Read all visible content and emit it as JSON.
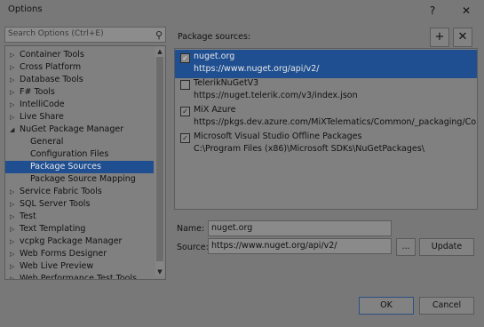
{
  "window": {
    "title": "Options",
    "help": "?",
    "close": "✕"
  },
  "search": {
    "placeholder": "Search Options (Ctrl+E)"
  },
  "tree": [
    {
      "label": "Container Tools",
      "arrow": "▷",
      "indent": 0
    },
    {
      "label": "Cross Platform",
      "arrow": "▷",
      "indent": 0
    },
    {
      "label": "Database Tools",
      "arrow": "▷",
      "indent": 0
    },
    {
      "label": "F# Tools",
      "arrow": "▷",
      "indent": 0
    },
    {
      "label": "IntelliCode",
      "arrow": "▷",
      "indent": 0
    },
    {
      "label": "Live Share",
      "arrow": "▷",
      "indent": 0
    },
    {
      "label": "NuGet Package Manager",
      "arrow": "◢",
      "indent": 0
    },
    {
      "label": "General",
      "arrow": "",
      "indent": 1
    },
    {
      "label": "Configuration Files",
      "arrow": "",
      "indent": 1
    },
    {
      "label": "Package Sources",
      "arrow": "",
      "indent": 1,
      "selected": true
    },
    {
      "label": "Package Source Mapping",
      "arrow": "",
      "indent": 1
    },
    {
      "label": "Service Fabric Tools",
      "arrow": "▷",
      "indent": 0
    },
    {
      "label": "SQL Server Tools",
      "arrow": "▷",
      "indent": 0
    },
    {
      "label": "Test",
      "arrow": "▷",
      "indent": 0
    },
    {
      "label": "Text Templating",
      "arrow": "▷",
      "indent": 0
    },
    {
      "label": "vcpkg Package Manager",
      "arrow": "▷",
      "indent": 0
    },
    {
      "label": "Web Forms Designer",
      "arrow": "▷",
      "indent": 0
    },
    {
      "label": "Web Live Preview",
      "arrow": "▷",
      "indent": 0
    },
    {
      "label": "Web Performance Test Tools",
      "arrow": "▷",
      "indent": 0
    }
  ],
  "scrollbar": {
    "up": "▲",
    "down": "▼"
  },
  "package_sources": {
    "label": "Package sources:",
    "add": "+",
    "remove": "✕",
    "items": [
      {
        "name": "nuget.org",
        "url": "https://www.nuget.org/api/v2/",
        "checked": true,
        "selected": true
      },
      {
        "name": "TelerikNuGetV3",
        "url": "https://nuget.telerik.com/v3/index.json",
        "checked": false,
        "selected": false
      },
      {
        "name": "MiX Azure",
        "url": "https://pkgs.dev.azure.com/MiXTelematics/Common/_packaging/Co...",
        "checked": true,
        "selected": false
      },
      {
        "name": "Microsoft Visual Studio Offline Packages",
        "url": "C:\\Program Files (x86)\\Microsoft SDKs\\NuGetPackages\\",
        "checked": true,
        "selected": false
      }
    ]
  },
  "form": {
    "name_label": "Name:",
    "name_value": "nuget.org",
    "source_label": "Source:",
    "source_value": "https://www.nuget.org/api/v2/",
    "browse": "...",
    "update": "Update"
  },
  "footer": {
    "ok": "OK",
    "cancel": "Cancel"
  }
}
